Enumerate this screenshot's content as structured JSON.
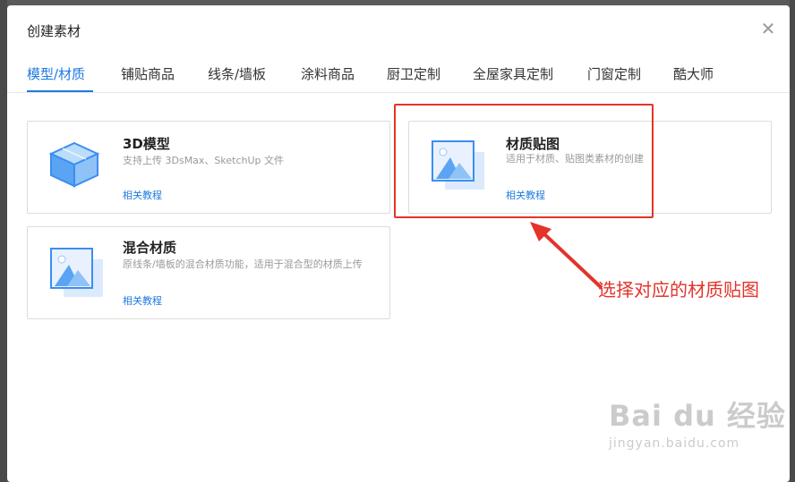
{
  "dialog": {
    "title": "创建素材",
    "close_icon": "close-icon"
  },
  "tabs": [
    {
      "label": "模型/材质",
      "active": true
    },
    {
      "label": "铺贴商品",
      "active": false
    },
    {
      "label": "线条/墙板",
      "active": false
    },
    {
      "label": "涂料商品",
      "active": false
    },
    {
      "label": "厨卫定制",
      "active": false
    },
    {
      "label": "全屋家具定制",
      "active": false
    },
    {
      "label": "门窗定制",
      "active": false
    },
    {
      "label": "酷大师",
      "active": false
    }
  ],
  "cards": {
    "model3d": {
      "title": "3D模型",
      "desc": "支持上传 3DsMax、SketchUp 文件",
      "link": "相关教程",
      "icon": "cube-icon"
    },
    "texture": {
      "title": "材质贴图",
      "desc": "适用于材质、贴图类素材的创建",
      "link": "相关教程",
      "icon": "image-icon"
    },
    "mixed": {
      "title": "混合材质",
      "desc": "原线条/墙板的混合材质功能，适用于混合型的材质上传",
      "link": "相关教程",
      "icon": "image-icon"
    }
  },
  "annotation": {
    "text": "选择对应的材质贴图",
    "color": "#e3332b"
  },
  "watermark": {
    "brand": "Bai du 经验",
    "url": "jingyan.baidu.com"
  },
  "colors": {
    "accent": "#1f7ae0",
    "highlight": "#e3332b"
  }
}
